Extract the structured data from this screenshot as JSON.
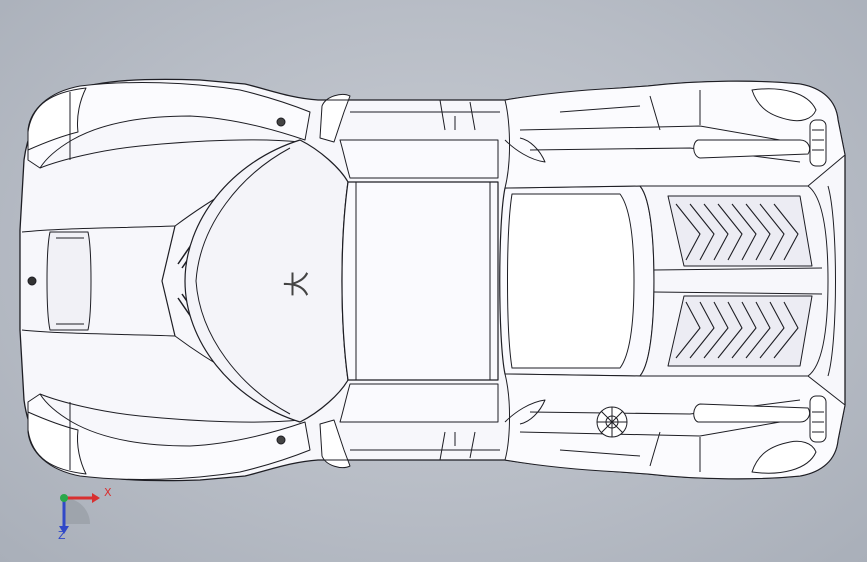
{
  "view": {
    "background_top": "#c8ccd3",
    "background_bottom": "#a9afb9",
    "model_color": "#f7f7fb",
    "edge_color": "#1e1e24"
  },
  "model": {
    "name": "car-body",
    "logo_glyph": "大"
  },
  "triad": {
    "x_label": "X",
    "z_label": "Z",
    "x_color": "#d83030",
    "y_color": "#2aa84a",
    "z_color": "#3048c8"
  }
}
